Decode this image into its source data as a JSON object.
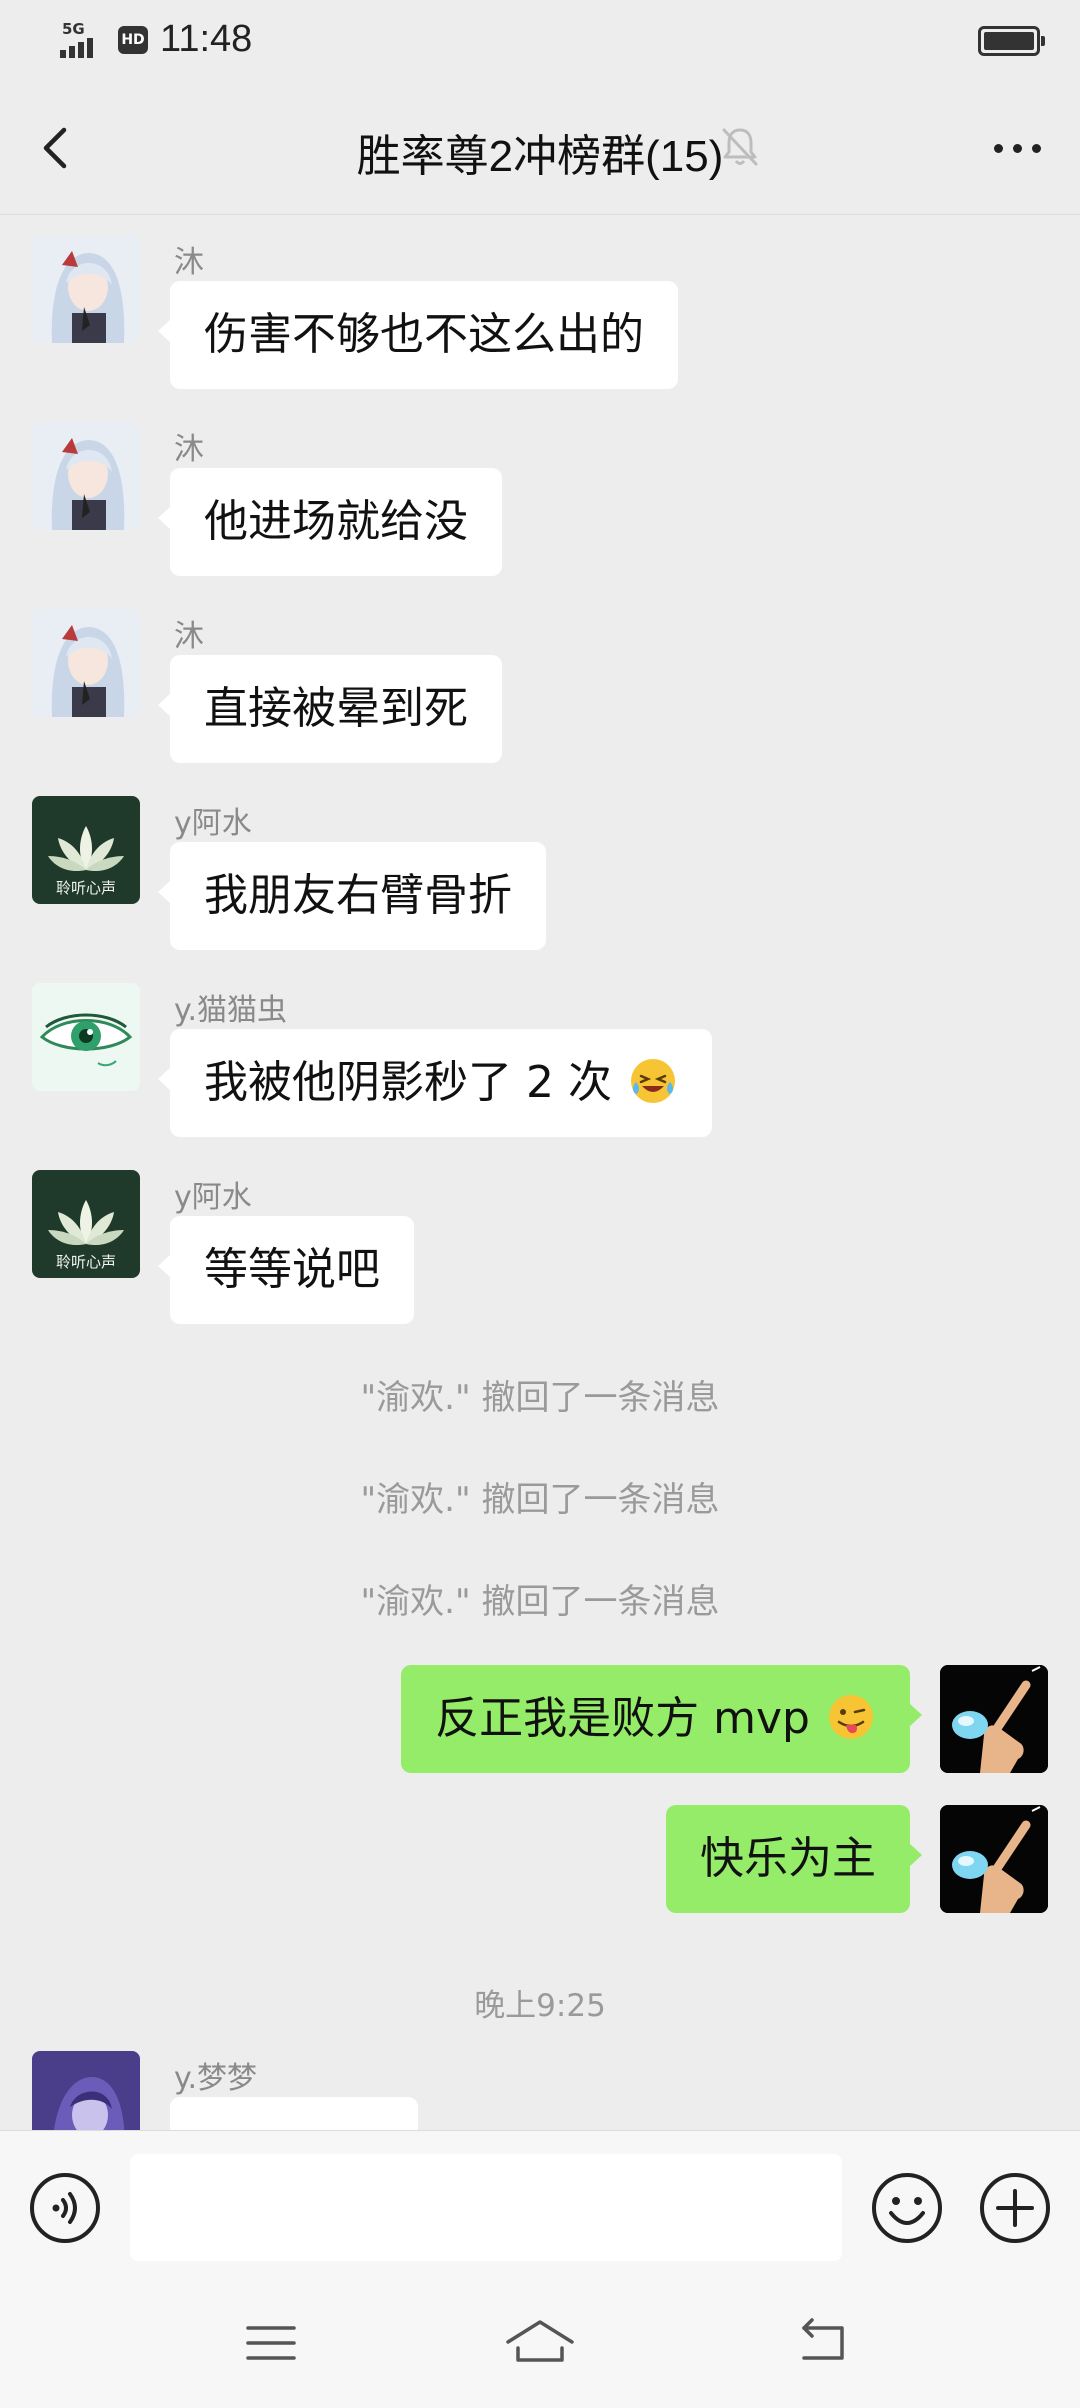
{
  "status_bar": {
    "network": "5G",
    "hd_badge": "HD",
    "time": "11:48"
  },
  "header": {
    "title": "胜率尊2冲榜群(15)"
  },
  "messages": [
    {
      "sender": "沐",
      "text": "伤害不够也不这么出的"
    },
    {
      "sender": "沐",
      "text": "他进场就给没"
    },
    {
      "sender": "沐",
      "text": "直接被晕到死"
    },
    {
      "sender": "y阿水",
      "text": "我朋友右臂骨折",
      "avatar_text": "聆听心声"
    },
    {
      "sender": "y.猫猫虫",
      "text": "我被他阴影秒了 2 次",
      "emoji": "laughing-crying-emoji"
    },
    {
      "sender": "y阿水",
      "text": "等等说吧",
      "avatar_text": "聆听心声"
    }
  ],
  "recall_notices": [
    "\"渝欢.\" 撤回了一条消息",
    "\"渝欢.\" 撤回了一条消息",
    "\"渝欢.\" 撤回了一条消息"
  ],
  "outgoing": [
    {
      "text": "反正我是败方 mvp",
      "emoji": "winking-tongue-emoji"
    },
    {
      "text": "快乐为主"
    }
  ],
  "timestamp": "晚上9:25",
  "last_message": {
    "sender": "y.梦梦"
  },
  "input_bar": {
    "placeholder": ""
  },
  "colors": {
    "background": "#ededed",
    "incoming_bubble": "#ffffff",
    "outgoing_bubble": "#95ec69",
    "meta_text": "#8a8a8a"
  }
}
